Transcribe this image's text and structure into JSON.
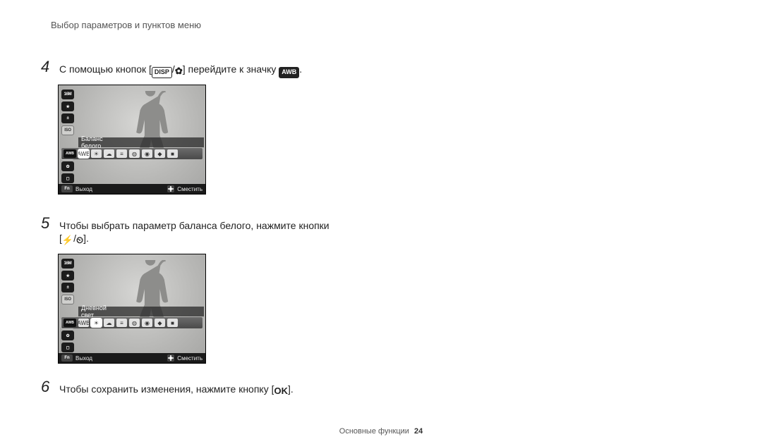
{
  "section_title": "Выбор параметров и пунктов меню",
  "steps": {
    "s4": {
      "num": "4",
      "text_a": "С помощью кнопок [",
      "text_b": "] перейдите к значку ",
      "text_c": ".",
      "lcd": {
        "row_label": "Баланс белого",
        "left_icons": [
          "16M",
          "★",
          "±",
          "ISO",
          "AWB",
          "✿",
          "◻"
        ],
        "bottom_exit": "Выход",
        "bottom_move": "Сместить"
      }
    },
    "s5": {
      "num": "5",
      "text": "Чтобы выбрать параметр баланса белого, нажмите кнопки",
      "sub_a": "[",
      "sub_b": "].",
      "lcd": {
        "row_label": "Дневной свет",
        "left_icons": [
          "16M",
          "★",
          "±",
          "ISO",
          "AWB",
          "✿",
          "◻"
        ],
        "bottom_exit": "Выход",
        "bottom_move": "Сместить"
      }
    },
    "s6": {
      "num": "6",
      "text_a": "Чтобы сохранить изменения, нажмите кнопку [",
      "text_b": "]."
    }
  },
  "icons": {
    "disp": "DISP",
    "macro": "✿",
    "awb": "AWB",
    "flash": "⚡",
    "timer": "⏲",
    "ok": "OK"
  },
  "options_row": [
    "AWB",
    "☀",
    "☁",
    "≡",
    "◍",
    "◉",
    "◆",
    "■"
  ],
  "footer": {
    "section": "Основные функции",
    "page": "24"
  }
}
